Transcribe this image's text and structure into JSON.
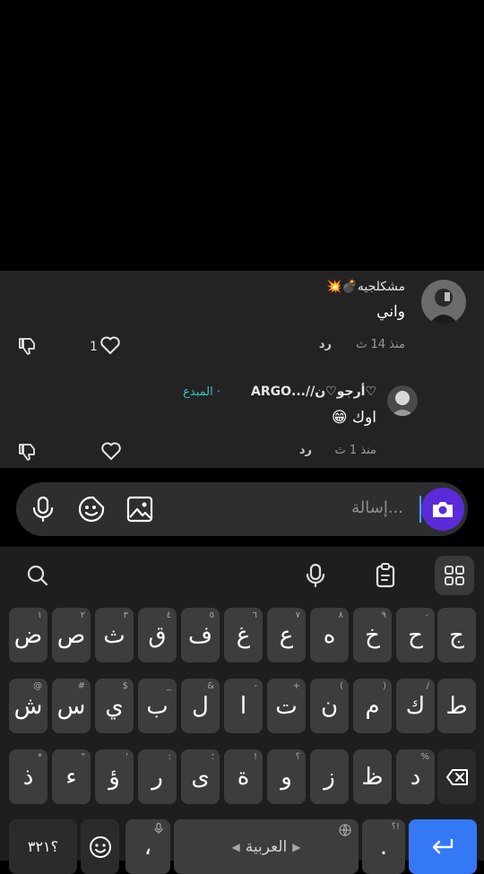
{
  "comments": [
    {
      "username": "مشكلجيه💣💥",
      "text": "واني",
      "time": "منذ 14 ث",
      "reply_label": "رد",
      "like_count": "1"
    },
    {
      "username": "♡أرجو♡ن//...ARGO",
      "creator_badge": "· المبدع",
      "text": "اوك 😁",
      "time": "منذ 1 ث",
      "reply_label": "رد",
      "like_count": ""
    }
  ],
  "input": {
    "placeholder": "...إسالة"
  },
  "keyboard": {
    "row1": [
      {
        "label": "ض",
        "hint": "١"
      },
      {
        "label": "ص",
        "hint": "٢"
      },
      {
        "label": "ث",
        "hint": "٣"
      },
      {
        "label": "ق",
        "hint": "٤"
      },
      {
        "label": "ف",
        "hint": "٥"
      },
      {
        "label": "غ",
        "hint": "٦"
      },
      {
        "label": "ع",
        "hint": "٧"
      },
      {
        "label": "ه",
        "hint": "٨"
      },
      {
        "label": "خ",
        "hint": "٩"
      },
      {
        "label": "ح",
        "hint": "٠"
      },
      {
        "label": "ج",
        "hint": ""
      }
    ],
    "row2": [
      {
        "label": "ش",
        "hint": "@"
      },
      {
        "label": "س",
        "hint": "#"
      },
      {
        "label": "ي",
        "hint": "$"
      },
      {
        "label": "ب",
        "hint": "_"
      },
      {
        "label": "ل",
        "hint": "&"
      },
      {
        "label": "ا",
        "hint": "-"
      },
      {
        "label": "ت",
        "hint": "+"
      },
      {
        "label": "ن",
        "hint": "("
      },
      {
        "label": "م",
        "hint": ")"
      },
      {
        "label": "ك",
        "hint": "/"
      },
      {
        "label": "ط",
        "hint": ""
      }
    ],
    "row3": [
      {
        "label": "ذ",
        "hint": "*"
      },
      {
        "label": "ء",
        "hint": "\""
      },
      {
        "label": "ؤ",
        "hint": "'"
      },
      {
        "label": "ر",
        "hint": ":"
      },
      {
        "label": "ى",
        "hint": "؛"
      },
      {
        "label": "ة",
        "hint": "!"
      },
      {
        "label": "و",
        "hint": "؟"
      },
      {
        "label": "ز",
        "hint": ""
      },
      {
        "label": "ظ",
        "hint": ""
      },
      {
        "label": "د",
        "hint": "%"
      }
    ],
    "row4": {
      "symbols": "؟٣٢١",
      "comma": "،",
      "space": "العربية",
      "period": ".",
      "period_hint": "؟!"
    }
  },
  "colors": {
    "accent": "#5a2bd9",
    "creator": "#39c0c8",
    "enter": "#3478f6"
  }
}
